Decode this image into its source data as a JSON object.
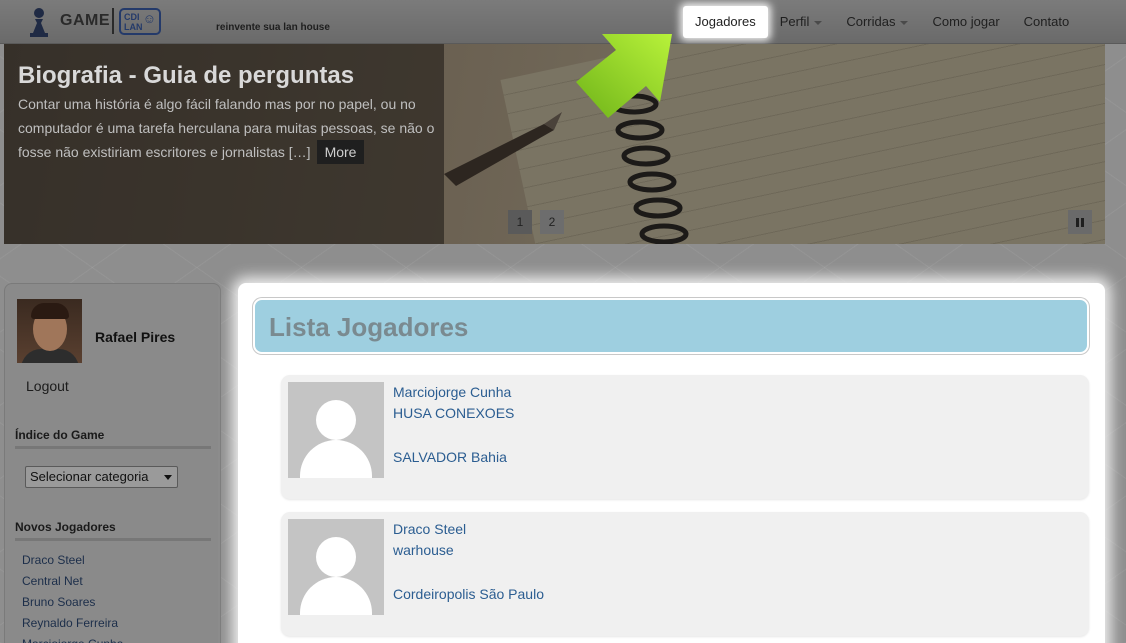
{
  "header": {
    "logo_text": "GAME",
    "badge_text_1": "CDI",
    "badge_text_2": "LAN",
    "tagline": "reinvente sua lan house",
    "nav": [
      {
        "label": "Jogadores",
        "active": true,
        "dropdown": false
      },
      {
        "label": "Perfil",
        "active": false,
        "dropdown": true
      },
      {
        "label": "Corridas",
        "active": false,
        "dropdown": true
      },
      {
        "label": "Como jogar",
        "active": false,
        "dropdown": false
      },
      {
        "label": "Contato",
        "active": false,
        "dropdown": false
      }
    ]
  },
  "slider": {
    "title": "Biografia - Guia de perguntas",
    "text": "Contar uma história é algo fácil falando mas por no papel, ou no computador é uma tarefa herculana para muitas pessoas, se não o fosse não existiriam escritores e jornalistas […]",
    "more_label": "More",
    "pages": [
      "1",
      "2"
    ],
    "active_page": "1"
  },
  "sidebar": {
    "user_name": "Rafael Pires",
    "logout_label": "Logout",
    "index_heading": "Índice do Game",
    "category_select": "Selecionar categoria",
    "new_players_heading": "Novos Jogadores",
    "new_players": [
      "Draco Steel",
      "Central Net",
      "Bruno Soares",
      "Reynaldo Ferreira",
      "Marciojorge Cunha"
    ]
  },
  "main": {
    "title": "Lista Jogadores",
    "players": [
      {
        "name": "Marciojorge Cunha",
        "house": "HUSA CONEXOES",
        "location": "SALVADOR Bahia"
      },
      {
        "name": "Draco Steel",
        "house": "warhouse",
        "location": "Cordeiropolis São Paulo"
      }
    ]
  },
  "colors": {
    "highlight_arrow": "#9ad61f",
    "title_bar": "#9ecfe0",
    "link": "#2b5d91"
  }
}
